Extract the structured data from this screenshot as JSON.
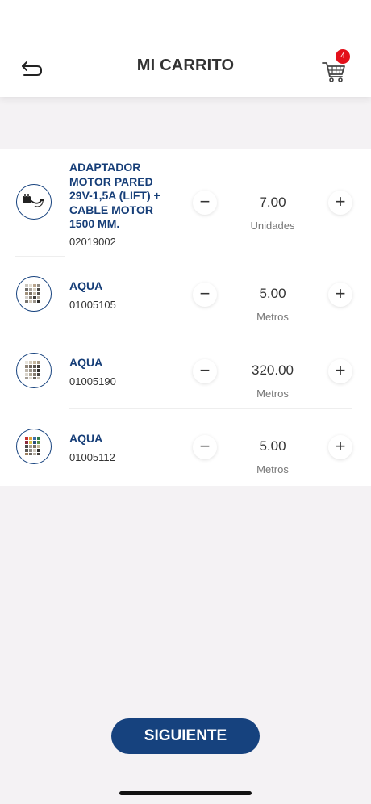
{
  "header": {
    "title": "MI CARRITO",
    "back_icon": "back-arrow-icon",
    "cart_icon": "shopping-cart-icon",
    "cart_count": "4"
  },
  "items": [
    {
      "name": "ADAPTADOR MOTOR PARED 29V-1,5A (LIFT) + CABLE MOTOR 1500 MM.",
      "code": "02019002",
      "qty": "7.00",
      "unit": "Unidades",
      "thumb": "adapter-image"
    },
    {
      "name": "AQUA",
      "code": "01005105",
      "qty": "5.00",
      "unit": "Metros",
      "thumb": "fabric-swatch-image"
    },
    {
      "name": "AQUA",
      "code": "01005190",
      "qty": "320.00",
      "unit": "Metros",
      "thumb": "fabric-swatch-image"
    },
    {
      "name": "AQUA",
      "code": "01005112",
      "qty": "5.00",
      "unit": "Metros",
      "thumb": "fabric-swatch-image"
    }
  ],
  "controls": {
    "minus": "−",
    "plus": "+"
  },
  "footer": {
    "next_label": "SIGUIENTE"
  },
  "colors": {
    "brand": "#16427e",
    "badge": "#e3101a",
    "background": "#f4f2f4"
  }
}
